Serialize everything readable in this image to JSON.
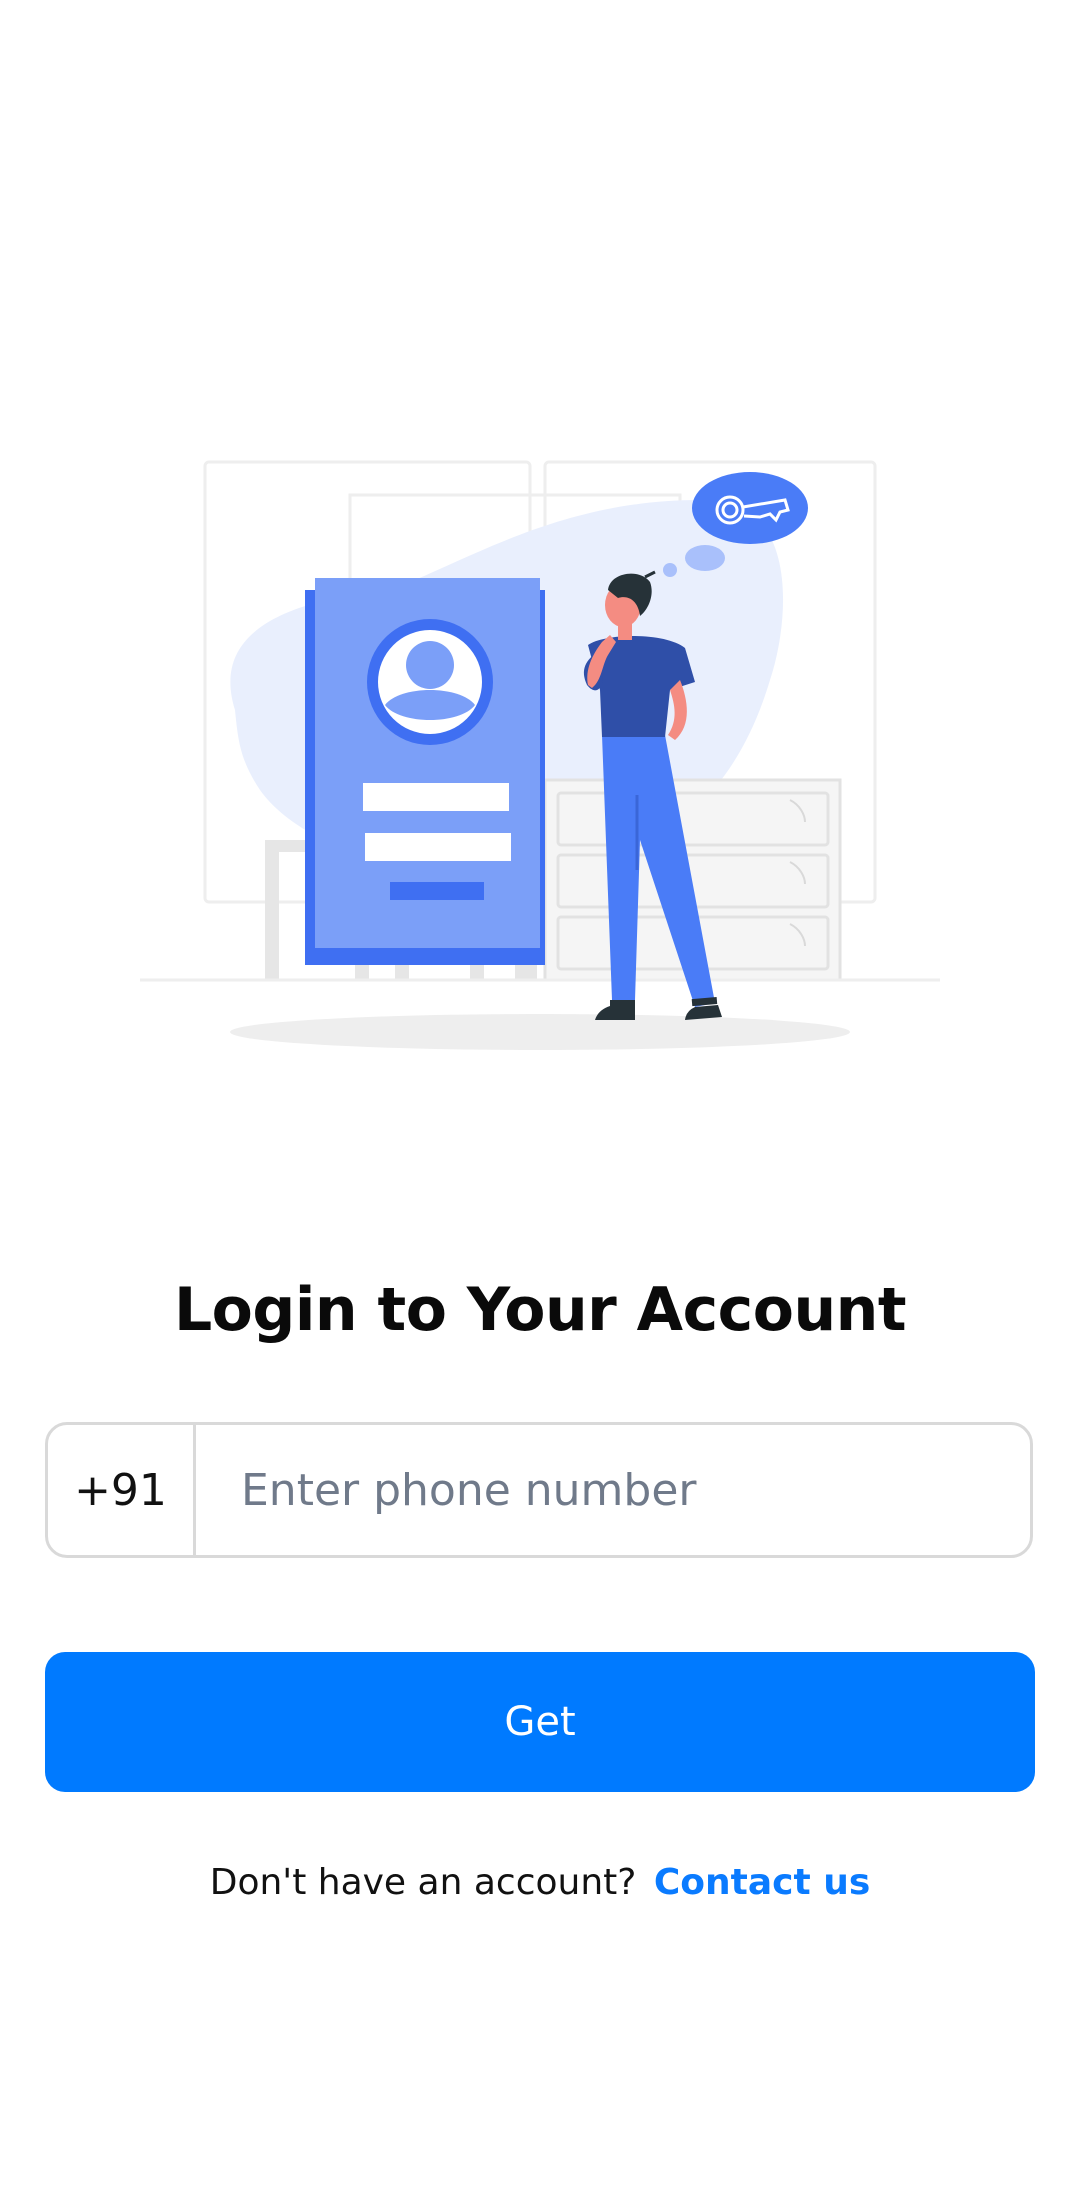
{
  "login": {
    "title": "Login to Your Account",
    "country_code": "+91",
    "phone_placeholder": "Enter phone number",
    "phone_value": "",
    "submit_label": "Get",
    "signup_prompt": "Don't have an account?",
    "contact_link": "Contact us"
  },
  "colors": {
    "accent": "#007aff",
    "illustration_blue": "#4a7cf7",
    "link": "#0a7bff"
  },
  "icons": {
    "illustration": "login-person-id-card-illustration",
    "key": "key-icon",
    "avatar": "user-avatar-icon"
  }
}
